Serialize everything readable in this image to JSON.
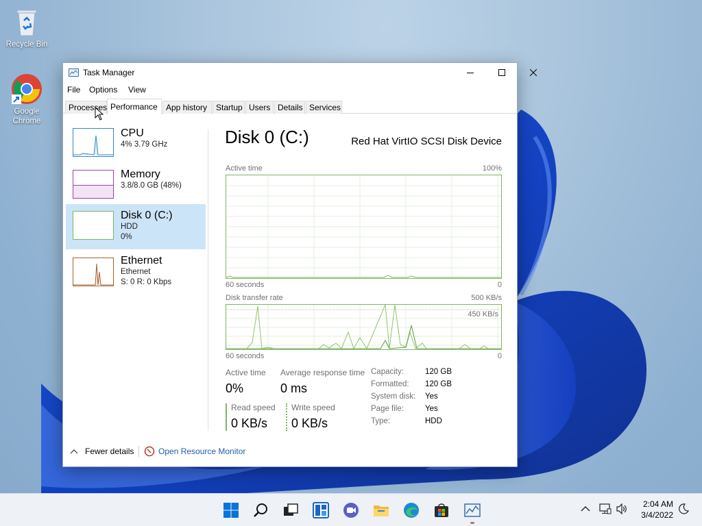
{
  "desktop": {
    "icons": [
      {
        "label": "Recycle Bin"
      },
      {
        "label": "Google Chrome"
      }
    ]
  },
  "window": {
    "title": "Task Manager",
    "menu": [
      "File",
      "Options",
      "View"
    ],
    "tabs": [
      "Processes",
      "Performance",
      "App history",
      "Startup",
      "Users",
      "Details",
      "Services"
    ],
    "active_tab": "Performance"
  },
  "sidebar": {
    "items": [
      {
        "name": "CPU",
        "sub1": "4%  3.79 GHz",
        "sub2": ""
      },
      {
        "name": "Memory",
        "sub1": "3.8/8.0 GB (48%)",
        "sub2": ""
      },
      {
        "name": "Disk 0 (C:)",
        "sub1": "HDD",
        "sub2": "0%"
      },
      {
        "name": "Ethernet",
        "sub1": "Ethernet",
        "sub2": "S: 0  R: 0 Kbps"
      }
    ],
    "selected": "Disk 0 (C:)"
  },
  "main": {
    "title": "Disk 0 (C:)",
    "model": "Red Hat VirtIO SCSI Disk Device",
    "graph1": {
      "label": "Active time",
      "max": "100%",
      "x_label": "60 seconds",
      "min": "0"
    },
    "graph2": {
      "label": "Disk transfer rate",
      "max": "500 KB/s",
      "mid": "450 KB/s",
      "x_label": "60 seconds",
      "min": "0"
    },
    "stats": {
      "active_time_label": "Active time",
      "active_time_value": "0%",
      "avg_response_label": "Average response time",
      "avg_response_value": "0 ms",
      "read_label": "Read speed",
      "read_value": "0 KB/s",
      "write_label": "Write speed",
      "write_value": "0 KB/s"
    },
    "properties": [
      {
        "key": "Capacity:",
        "value": "120 GB"
      },
      {
        "key": "Formatted:",
        "value": "120 GB"
      },
      {
        "key": "System disk:",
        "value": "Yes"
      },
      {
        "key": "Page file:",
        "value": "Yes"
      },
      {
        "key": "Type:",
        "value": "HDD"
      }
    ]
  },
  "footer": {
    "fewer_details": "Fewer details",
    "resource_monitor": "Open Resource Monitor"
  },
  "taskbar": {
    "time": "2:04 AM",
    "date": "3/4/2022"
  },
  "colors": {
    "disk_green": "#7cb65f",
    "cpu_blue": "#2f87c8",
    "memory_purple": "#9b40a8",
    "ethernet_brown": "#a7612b",
    "selected_bg": "#cce4f7",
    "link": "#1f5fa8"
  }
}
